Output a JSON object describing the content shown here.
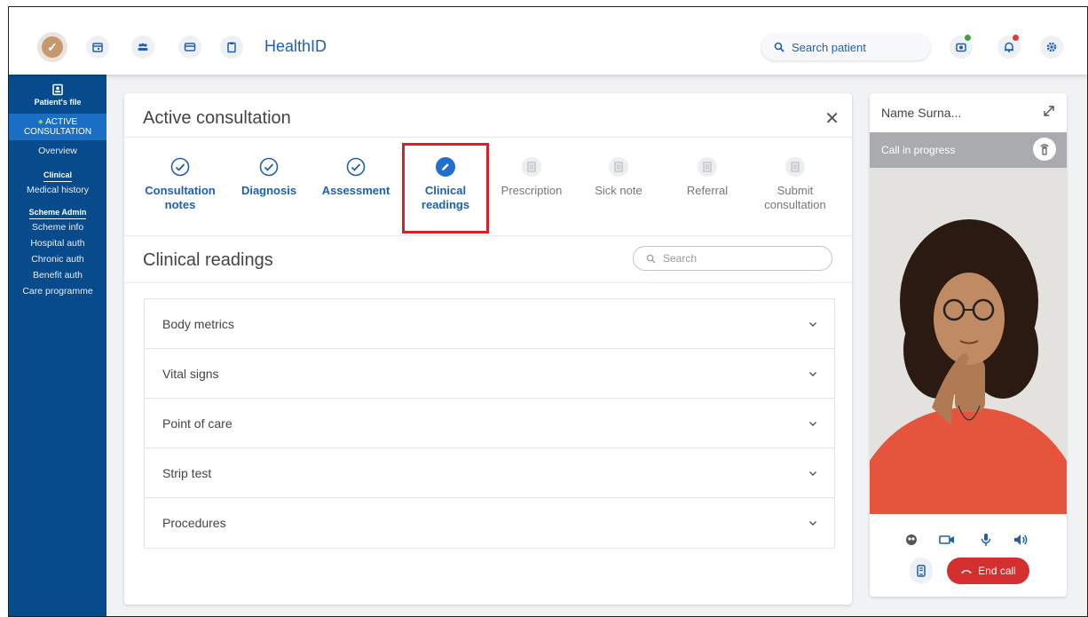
{
  "header": {
    "app_title": "HealthID",
    "search_placeholder": "Search patient",
    "nav_icons": [
      "calendar-icon",
      "people-icon",
      "card-icon",
      "clipboard-icon"
    ],
    "right_icons": [
      "camera-notification-icon",
      "bell-notification-icon",
      "settings-icon"
    ],
    "badge_colors": {
      "green": "#43a047",
      "red": "#e53935"
    }
  },
  "sidebar": {
    "patient_file": "Patient's file",
    "active_label_1": "ACTIVE",
    "active_label_2": "CONSULTATION",
    "overview": "Overview",
    "clinical_heading": "Clinical",
    "medical_history": "Medical history",
    "scheme_heading": "Scheme Admin",
    "scheme_items": [
      "Scheme info",
      "Hospital auth",
      "Chronic auth",
      "Benefit auth",
      "Care programme"
    ]
  },
  "consultation": {
    "title": "Active consultation",
    "steps": [
      {
        "line1": "Consultation",
        "line2": "notes",
        "state": "done"
      },
      {
        "line1": "Diagnosis",
        "line2": "",
        "state": "done"
      },
      {
        "line1": "Assessment",
        "line2": "",
        "state": "done"
      },
      {
        "line1": "Clinical",
        "line2": "readings",
        "state": "current"
      },
      {
        "line1": "Prescription",
        "line2": "",
        "state": "todo"
      },
      {
        "line1": "Sick note",
        "line2": "",
        "state": "todo"
      },
      {
        "line1": "Referral",
        "line2": "",
        "state": "todo"
      },
      {
        "line1": "Submit",
        "line2": "consultation",
        "state": "todo"
      }
    ],
    "section_title": "Clinical readings",
    "search_placeholder": "Search",
    "accordion": [
      "Body metrics",
      "Vital signs",
      "Point of care",
      "Strip test",
      "Procedures"
    ]
  },
  "call": {
    "name": "Name Surna...",
    "status": "Call in progress",
    "end_call": "End call"
  },
  "colors": {
    "accent": "#1f5fb0",
    "sidebar": "#074b8c",
    "end_call": "#d32f2f",
    "highlight": "#d61f26"
  }
}
